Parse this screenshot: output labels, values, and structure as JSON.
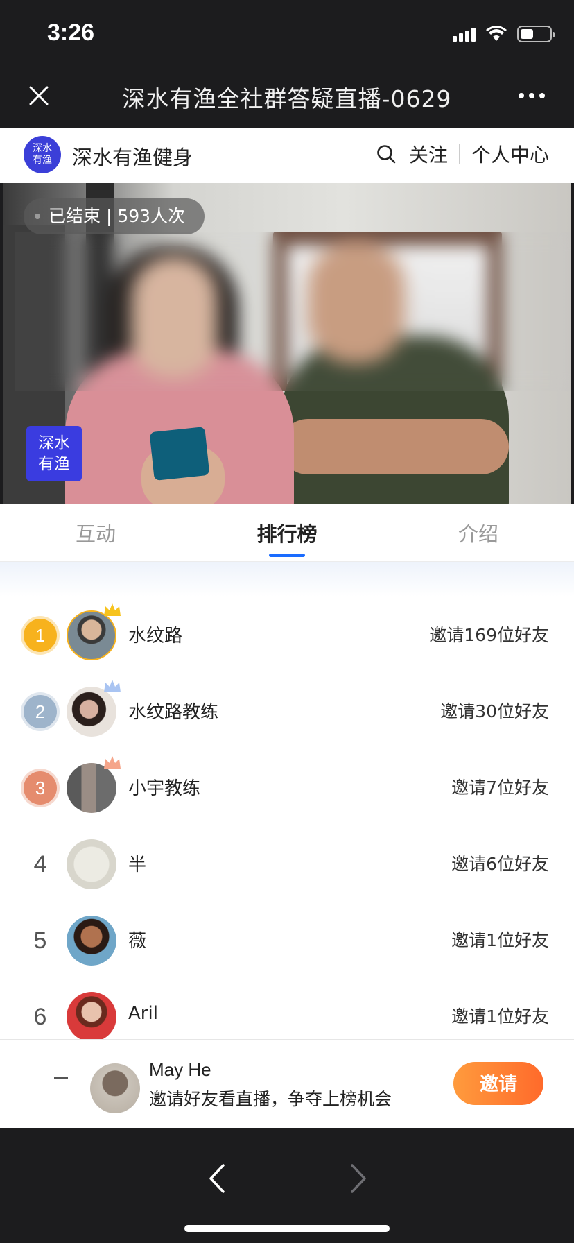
{
  "status_bar": {
    "time": "3:26",
    "battery_level": 0.45
  },
  "nav": {
    "title": "深水有渔全社群答疑直播-0629"
  },
  "channel": {
    "logo_text": "深水有渔",
    "name": "深水有渔健身",
    "follow_label": "关注",
    "profile_label": "个人中心"
  },
  "video": {
    "status": "已结束 | 593人次",
    "watermark": "深水有渔"
  },
  "tabs": [
    {
      "label": "互动",
      "active": false
    },
    {
      "label": "排行榜",
      "active": true
    },
    {
      "label": "介绍",
      "active": false
    }
  ],
  "ranking": [
    {
      "rank": "1",
      "name": "水纹路",
      "invite": "邀请169位好友",
      "badge_color": "#f7b21d",
      "crown_color": "#f7c31d"
    },
    {
      "rank": "2",
      "name": "水纹路教练",
      "invite": "邀请30位好友",
      "badge_color": "#9eb4cb",
      "crown_color": "#a9c4f2"
    },
    {
      "rank": "3",
      "name": "小宇教练",
      "invite": "邀请7位好友",
      "badge_color": "#e58c6e",
      "crown_color": "#f5a58a"
    },
    {
      "rank": "4",
      "name": "半",
      "invite": "邀请6位好友"
    },
    {
      "rank": "5",
      "name": "薇",
      "invite": "邀请1位好友"
    },
    {
      "rank": "6",
      "name": "Aril",
      "invite": "邀请1位好友"
    }
  ],
  "me": {
    "name": "May He",
    "tip": "邀请好友看直播，争夺上榜机会",
    "invite_label": "邀请"
  },
  "colors": {
    "accent": "#1a6cff",
    "invite_button": "#ff7a2f",
    "dark_bar": "#1c1c1e"
  }
}
